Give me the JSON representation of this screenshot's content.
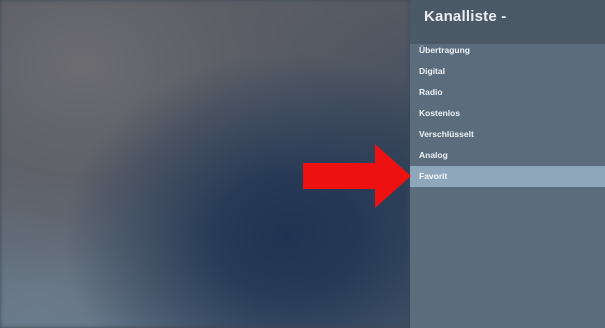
{
  "panel": {
    "title": "Kanalliste -",
    "items": [
      {
        "label": "Übertragung"
      },
      {
        "label": "Digital"
      },
      {
        "label": "Radio"
      },
      {
        "label": "Kostenlos"
      },
      {
        "label": "Verschlüsselt"
      },
      {
        "label": "Analog"
      },
      {
        "label": "Favorit",
        "selected": true
      }
    ]
  },
  "colors": {
    "panel_background": "#5b6d7d",
    "header_background": "#4b5967",
    "selected_background": "#8fa7bb",
    "arrow": "#ee1111"
  },
  "icons": {
    "pointer": "red-arrow-right-icon"
  }
}
